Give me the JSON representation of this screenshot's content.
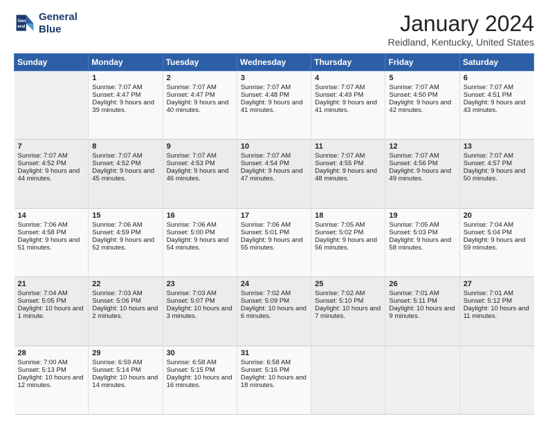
{
  "header": {
    "logo_line1": "General",
    "logo_line2": "Blue",
    "title": "January 2024",
    "location": "Reidland, Kentucky, United States"
  },
  "days_of_week": [
    "Sunday",
    "Monday",
    "Tuesday",
    "Wednesday",
    "Thursday",
    "Friday",
    "Saturday"
  ],
  "weeks": [
    [
      {
        "day": "",
        "sunrise": "",
        "sunset": "",
        "daylight": ""
      },
      {
        "day": "1",
        "sunrise": "Sunrise: 7:07 AM",
        "sunset": "Sunset: 4:47 PM",
        "daylight": "Daylight: 9 hours and 39 minutes."
      },
      {
        "day": "2",
        "sunrise": "Sunrise: 7:07 AM",
        "sunset": "Sunset: 4:47 PM",
        "daylight": "Daylight: 9 hours and 40 minutes."
      },
      {
        "day": "3",
        "sunrise": "Sunrise: 7:07 AM",
        "sunset": "Sunset: 4:48 PM",
        "daylight": "Daylight: 9 hours and 41 minutes."
      },
      {
        "day": "4",
        "sunrise": "Sunrise: 7:07 AM",
        "sunset": "Sunset: 4:49 PM",
        "daylight": "Daylight: 9 hours and 41 minutes."
      },
      {
        "day": "5",
        "sunrise": "Sunrise: 7:07 AM",
        "sunset": "Sunset: 4:50 PM",
        "daylight": "Daylight: 9 hours and 42 minutes."
      },
      {
        "day": "6",
        "sunrise": "Sunrise: 7:07 AM",
        "sunset": "Sunset: 4:51 PM",
        "daylight": "Daylight: 9 hours and 43 minutes."
      }
    ],
    [
      {
        "day": "7",
        "sunrise": "Sunrise: 7:07 AM",
        "sunset": "Sunset: 4:52 PM",
        "daylight": "Daylight: 9 hours and 44 minutes."
      },
      {
        "day": "8",
        "sunrise": "Sunrise: 7:07 AM",
        "sunset": "Sunset: 4:52 PM",
        "daylight": "Daylight: 9 hours and 45 minutes."
      },
      {
        "day": "9",
        "sunrise": "Sunrise: 7:07 AM",
        "sunset": "Sunset: 4:53 PM",
        "daylight": "Daylight: 9 hours and 46 minutes."
      },
      {
        "day": "10",
        "sunrise": "Sunrise: 7:07 AM",
        "sunset": "Sunset: 4:54 PM",
        "daylight": "Daylight: 9 hours and 47 minutes."
      },
      {
        "day": "11",
        "sunrise": "Sunrise: 7:07 AM",
        "sunset": "Sunset: 4:55 PM",
        "daylight": "Daylight: 9 hours and 48 minutes."
      },
      {
        "day": "12",
        "sunrise": "Sunrise: 7:07 AM",
        "sunset": "Sunset: 4:56 PM",
        "daylight": "Daylight: 9 hours and 49 minutes."
      },
      {
        "day": "13",
        "sunrise": "Sunrise: 7:07 AM",
        "sunset": "Sunset: 4:57 PM",
        "daylight": "Daylight: 9 hours and 50 minutes."
      }
    ],
    [
      {
        "day": "14",
        "sunrise": "Sunrise: 7:06 AM",
        "sunset": "Sunset: 4:58 PM",
        "daylight": "Daylight: 9 hours and 51 minutes."
      },
      {
        "day": "15",
        "sunrise": "Sunrise: 7:06 AM",
        "sunset": "Sunset: 4:59 PM",
        "daylight": "Daylight: 9 hours and 52 minutes."
      },
      {
        "day": "16",
        "sunrise": "Sunrise: 7:06 AM",
        "sunset": "Sunset: 5:00 PM",
        "daylight": "Daylight: 9 hours and 54 minutes."
      },
      {
        "day": "17",
        "sunrise": "Sunrise: 7:06 AM",
        "sunset": "Sunset: 5:01 PM",
        "daylight": "Daylight: 9 hours and 55 minutes."
      },
      {
        "day": "18",
        "sunrise": "Sunrise: 7:05 AM",
        "sunset": "Sunset: 5:02 PM",
        "daylight": "Daylight: 9 hours and 56 minutes."
      },
      {
        "day": "19",
        "sunrise": "Sunrise: 7:05 AM",
        "sunset": "Sunset: 5:03 PM",
        "daylight": "Daylight: 9 hours and 58 minutes."
      },
      {
        "day": "20",
        "sunrise": "Sunrise: 7:04 AM",
        "sunset": "Sunset: 5:04 PM",
        "daylight": "Daylight: 9 hours and 59 minutes."
      }
    ],
    [
      {
        "day": "21",
        "sunrise": "Sunrise: 7:04 AM",
        "sunset": "Sunset: 5:05 PM",
        "daylight": "Daylight: 10 hours and 1 minute."
      },
      {
        "day": "22",
        "sunrise": "Sunrise: 7:03 AM",
        "sunset": "Sunset: 5:06 PM",
        "daylight": "Daylight: 10 hours and 2 minutes."
      },
      {
        "day": "23",
        "sunrise": "Sunrise: 7:03 AM",
        "sunset": "Sunset: 5:07 PM",
        "daylight": "Daylight: 10 hours and 3 minutes."
      },
      {
        "day": "24",
        "sunrise": "Sunrise: 7:02 AM",
        "sunset": "Sunset: 5:09 PM",
        "daylight": "Daylight: 10 hours and 6 minutes."
      },
      {
        "day": "25",
        "sunrise": "Sunrise: 7:02 AM",
        "sunset": "Sunset: 5:10 PM",
        "daylight": "Daylight: 10 hours and 7 minutes."
      },
      {
        "day": "26",
        "sunrise": "Sunrise: 7:01 AM",
        "sunset": "Sunset: 5:11 PM",
        "daylight": "Daylight: 10 hours and 9 minutes."
      },
      {
        "day": "27",
        "sunrise": "Sunrise: 7:01 AM",
        "sunset": "Sunset: 5:12 PM",
        "daylight": "Daylight: 10 hours and 11 minutes."
      }
    ],
    [
      {
        "day": "28",
        "sunrise": "Sunrise: 7:00 AM",
        "sunset": "Sunset: 5:13 PM",
        "daylight": "Daylight: 10 hours and 12 minutes."
      },
      {
        "day": "29",
        "sunrise": "Sunrise: 6:59 AM",
        "sunset": "Sunset: 5:14 PM",
        "daylight": "Daylight: 10 hours and 14 minutes."
      },
      {
        "day": "30",
        "sunrise": "Sunrise: 6:58 AM",
        "sunset": "Sunset: 5:15 PM",
        "daylight": "Daylight: 10 hours and 16 minutes."
      },
      {
        "day": "31",
        "sunrise": "Sunrise: 6:58 AM",
        "sunset": "Sunset: 5:16 PM",
        "daylight": "Daylight: 10 hours and 18 minutes."
      },
      {
        "day": "",
        "sunrise": "",
        "sunset": "",
        "daylight": ""
      },
      {
        "day": "",
        "sunrise": "",
        "sunset": "",
        "daylight": ""
      },
      {
        "day": "",
        "sunrise": "",
        "sunset": "",
        "daylight": ""
      }
    ]
  ]
}
